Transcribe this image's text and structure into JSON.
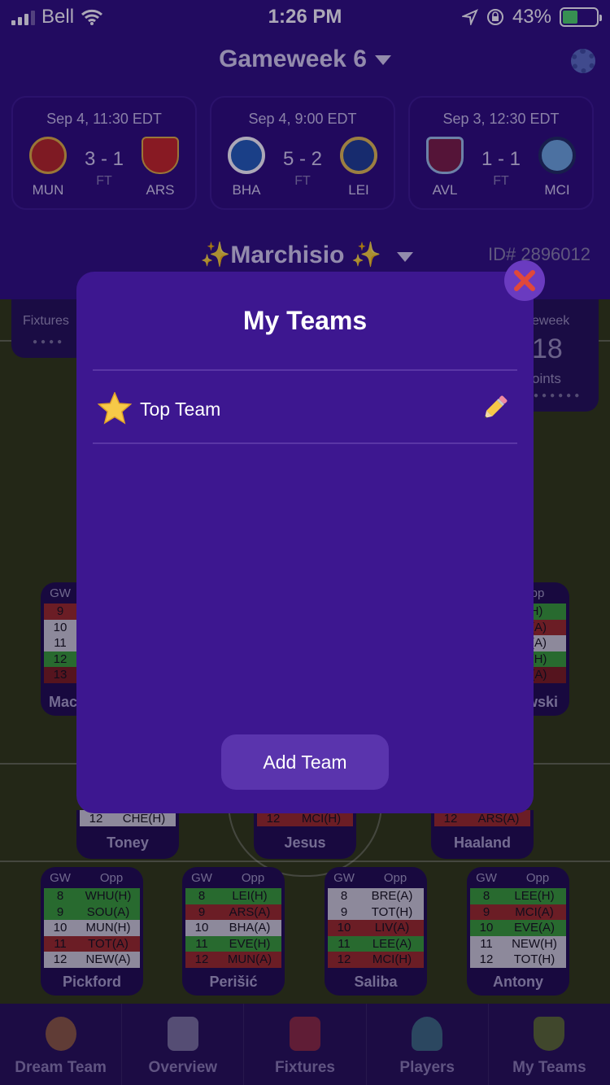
{
  "status_bar": {
    "carrier": "Bell",
    "time": "1:26 PM",
    "battery": "43%",
    "battery_level": 0.43,
    "icons": [
      "signal-icon",
      "wifi-icon",
      "location-icon",
      "rotation-lock-icon",
      "battery-charging-icon"
    ]
  },
  "header": {
    "gameweek_title": "Gameweek 6",
    "settings_icon": "gear-icon",
    "matches": [
      {
        "date": "Sep 4, 11:30 EDT",
        "home": "MUN",
        "away": "ARS",
        "score": "3 - 1",
        "status": "FT"
      },
      {
        "date": "Sep 4, 9:00 EDT",
        "home": "BHA",
        "away": "LEI",
        "score": "5 - 2",
        "status": "FT"
      },
      {
        "date": "Sep 3, 12:30 EDT",
        "home": "AVL",
        "away": "MCI",
        "score": "1 - 1",
        "status": "FT"
      }
    ],
    "team_name": "✨Marchisio ✨",
    "team_id": "ID# 2896012"
  },
  "stats": {
    "left_title": "Fixtures",
    "right_title": "eweek",
    "right_value": "18",
    "right_unit": "oints"
  },
  "cards": {
    "partial_left": {
      "gw_header": "GW",
      "gws": [
        "9",
        "10",
        "11",
        "12",
        "13"
      ],
      "name": "Mac"
    },
    "partial_right": {
      "opp_header": "pp",
      "opps": [
        "(H)",
        "S(A)",
        "A(A)",
        "E(H)",
        "N(A)"
      ],
      "name": "wski"
    },
    "mid_row": [
      {
        "gw": "12",
        "opp": "CHE(H)",
        "name": "Toney"
      },
      {
        "gw": "12",
        "opp": "MCI(H)",
        "name": "Jesus"
      },
      {
        "gw": "12",
        "opp": "ARS(A)",
        "name": "Haaland"
      }
    ],
    "headers": {
      "gw": "GW",
      "opp": "Opp"
    },
    "bottom_row": [
      {
        "name": "Pickford",
        "rows": [
          [
            "8",
            "WHU(H)"
          ],
          [
            "9",
            "SOU(A)"
          ],
          [
            "10",
            "MUN(H)"
          ],
          [
            "11",
            "TOT(A)"
          ],
          [
            "12",
            "NEW(A)"
          ]
        ]
      },
      {
        "name": "Perišić",
        "rows": [
          [
            "8",
            "LEI(H)"
          ],
          [
            "9",
            "ARS(A)"
          ],
          [
            "10",
            "BHA(A)"
          ],
          [
            "11",
            "EVE(H)"
          ],
          [
            "12",
            "MUN(A)"
          ]
        ]
      },
      {
        "name": "Saliba",
        "rows": [
          [
            "8",
            "BRE(A)"
          ],
          [
            "9",
            "TOT(H)"
          ],
          [
            "10",
            "LIV(A)"
          ],
          [
            "11",
            "LEE(A)"
          ],
          [
            "12",
            "MCI(H)"
          ]
        ]
      },
      {
        "name": "Antony",
        "rows": [
          [
            "8",
            "LEE(H)"
          ],
          [
            "9",
            "MCI(A)"
          ],
          [
            "10",
            "EVE(A)"
          ],
          [
            "11",
            "NEW(H)"
          ],
          [
            "12",
            "TOT(H)"
          ]
        ]
      }
    ]
  },
  "tabs": [
    {
      "label": "Dream Team",
      "icon": "medal-icon"
    },
    {
      "label": "Overview",
      "icon": "tactics-board-icon"
    },
    {
      "label": "Fixtures",
      "icon": "calendar-icon"
    },
    {
      "label": "Players",
      "icon": "player-search-icon"
    },
    {
      "label": "My Teams",
      "icon": "club-badge-icon"
    }
  ],
  "modal": {
    "title": "My Teams",
    "teams": [
      {
        "name": "Top Team",
        "icon": "star-icon",
        "edit_icon": "pencil-icon"
      }
    ],
    "add_button": "Add Team",
    "close_icon": "close-icon"
  },
  "colors": {
    "header_bg": "#2c0f7a",
    "modal_bg": "#3d1790",
    "add_button_bg": "#5a34ad",
    "close_red": "#e0483a",
    "fixture_green": "#35a02e",
    "fixture_red": "#9c2a20",
    "fixture_grey": "#cfcfd4"
  }
}
